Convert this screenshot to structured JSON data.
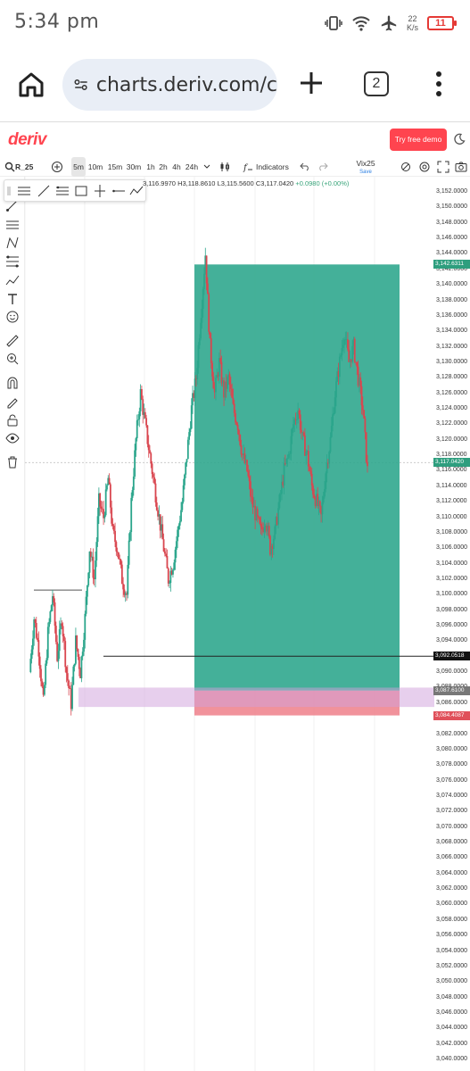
{
  "statusbar": {
    "time": "5:34 pm",
    "net_speed_value": "22",
    "net_speed_unit": "K/s",
    "battery": "11"
  },
  "browser": {
    "url": "charts.deriv.com/c",
    "tab_count": "2"
  },
  "deriv": {
    "logo": "deriv",
    "try_free_label": "Try free demo"
  },
  "toolbar": {
    "symbol": "R_25",
    "timeframes": [
      "5m",
      "10m",
      "15m",
      "30m",
      "1h",
      "2h",
      "4h",
      "24h"
    ],
    "active_timeframe": "5m",
    "indicators_label": "Indicators",
    "template_name": "Vix25",
    "template_sub": "Save"
  },
  "ohlc": {
    "open": "3,116.9970",
    "high": "H3,118.8610",
    "low": "L3,115.5600",
    "close": "C3,117.0420",
    "change": "+0.0980 (+0.00%)"
  },
  "chart_data": {
    "type": "candlestick",
    "symbol": "R_25",
    "interval": "5m",
    "ylim": [
      3040,
      3152
    ],
    "y_ticks": [
      "3,152.0000",
      "3,150.0000",
      "3,148.0000",
      "3,146.0000",
      "3,144.0000",
      "3,142.0000",
      "3,140.0000",
      "3,138.0000",
      "3,136.0000",
      "3,134.0000",
      "3,132.0000",
      "3,130.0000",
      "3,128.0000",
      "3,126.0000",
      "3,124.0000",
      "3,122.0000",
      "3,120.0000",
      "3,118.0000",
      "3,116.0000",
      "3,114.0000",
      "3,112.0000",
      "3,110.0000",
      "3,108.0000",
      "3,106.0000",
      "3,104.0000",
      "3,102.0000",
      "3,100.0000",
      "3,098.0000",
      "3,096.0000",
      "3,094.0000",
      "3,092.0000",
      "3,090.0000",
      "3,088.0000",
      "3,086.0000",
      "3,084.0000",
      "3,082.0000",
      "3,080.0000",
      "3,078.0000",
      "3,076.0000",
      "3,074.0000",
      "3,072.0000",
      "3,070.0000",
      "3,068.0000",
      "3,066.0000",
      "3,064.0000",
      "3,062.0000",
      "3,060.0000",
      "3,058.0000",
      "3,056.0000",
      "3,054.0000",
      "3,052.0000",
      "3,050.0000",
      "3,048.0000",
      "3,046.0000",
      "3,044.0000",
      "3,042.0000",
      "3,040.0000"
    ],
    "price_tags": [
      {
        "label": "3,142.6311",
        "value": 3142.6311,
        "color": "#2e9e7e"
      },
      {
        "label": "3,117.0420",
        "value": 3117.042,
        "color": "#2e9e7e"
      },
      {
        "label": "3,092.0518",
        "value": 3092.0518,
        "color": "#111111"
      },
      {
        "label": "3,087.6100",
        "value": 3087.61,
        "color": "#777777"
      },
      {
        "label": "3,084.4087",
        "value": 3084.4087,
        "color": "#e0505a"
      }
    ],
    "close_path": [
      [
        0,
        3090
      ],
      [
        2,
        3097
      ],
      [
        4,
        3093
      ],
      [
        6,
        3086
      ],
      [
        8,
        3095
      ],
      [
        10,
        3100
      ],
      [
        12,
        3092
      ],
      [
        14,
        3097
      ],
      [
        16,
        3090
      ],
      [
        18,
        3086
      ],
      [
        20,
        3094
      ],
      [
        22,
        3090
      ],
      [
        24,
        3097
      ],
      [
        26,
        3106
      ],
      [
        28,
        3102
      ],
      [
        30,
        3112
      ],
      [
        32,
        3110
      ],
      [
        34,
        3115
      ],
      [
        36,
        3108
      ],
      [
        38,
        3106
      ],
      [
        40,
        3102
      ],
      [
        42,
        3100
      ],
      [
        44,
        3112
      ],
      [
        46,
        3120
      ],
      [
        48,
        3126
      ],
      [
        50,
        3122
      ],
      [
        52,
        3118
      ],
      [
        54,
        3114
      ],
      [
        56,
        3110
      ],
      [
        58,
        3106
      ],
      [
        60,
        3102
      ],
      [
        62,
        3104
      ],
      [
        64,
        3108
      ],
      [
        66,
        3112
      ],
      [
        68,
        3118
      ],
      [
        70,
        3124
      ],
      [
        72,
        3128
      ],
      [
        74,
        3136
      ],
      [
        76,
        3144
      ],
      [
        78,
        3132
      ],
      [
        80,
        3126
      ],
      [
        82,
        3130
      ],
      [
        84,
        3126
      ],
      [
        86,
        3128
      ],
      [
        88,
        3124
      ],
      [
        90,
        3122
      ],
      [
        92,
        3118
      ],
      [
        94,
        3116
      ],
      [
        96,
        3112
      ],
      [
        98,
        3110
      ],
      [
        100,
        3108
      ],
      [
        102,
        3110
      ],
      [
        104,
        3106
      ],
      [
        106,
        3108
      ],
      [
        108,
        3112
      ],
      [
        110,
        3116
      ],
      [
        112,
        3118
      ],
      [
        114,
        3122
      ],
      [
        116,
        3124
      ],
      [
        118,
        3120
      ],
      [
        120,
        3118
      ],
      [
        122,
        3114
      ],
      [
        124,
        3112
      ],
      [
        126,
        3110
      ],
      [
        128,
        3116
      ],
      [
        130,
        3120
      ],
      [
        132,
        3126
      ],
      [
        134,
        3130
      ],
      [
        136,
        3134
      ],
      [
        138,
        3130
      ],
      [
        140,
        3132
      ],
      [
        142,
        3128
      ],
      [
        144,
        3124
      ],
      [
        146,
        3116
      ]
    ],
    "drawings": [
      {
        "type": "long_position",
        "entry": 3087.61,
        "target": 3142.6311,
        "stop": 3084.4087
      },
      {
        "type": "horizontal_line",
        "value": 3092.0518
      },
      {
        "type": "zone",
        "from": 3088.0,
        "to": 3085.5
      },
      {
        "type": "horizontal_line",
        "value": 3100.6
      }
    ]
  }
}
